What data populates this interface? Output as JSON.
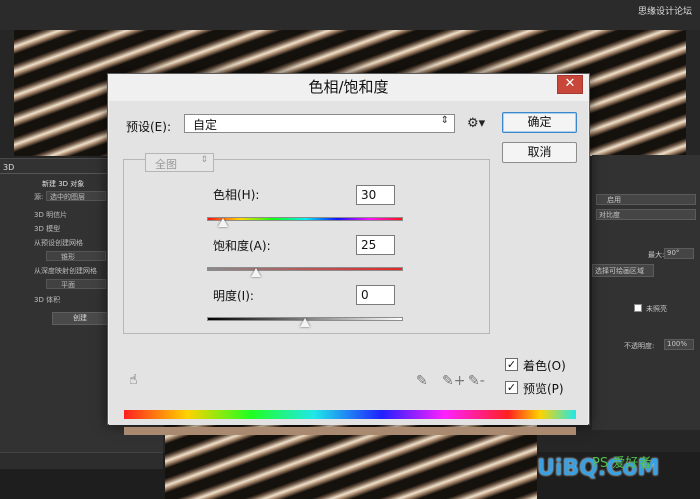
{
  "dialog": {
    "title": "色相/饱和度",
    "close_glyph": "✕",
    "preset_label": "预设(E):",
    "preset_value": "自定",
    "preset_arrow": "⇕",
    "gear_icon": "⚙▾",
    "ok_label": "确定",
    "cancel_label": "取消",
    "channel_value": "全图",
    "channel_arrow": "⇕",
    "hue": {
      "label": "色相(H):",
      "value": "30"
    },
    "saturation": {
      "label": "饱和度(A):",
      "value": "25"
    },
    "lightness": {
      "label": "明度(I):",
      "value": "0"
    },
    "colorize": {
      "label": "着色(O)",
      "checked": true
    },
    "preview": {
      "label": "预览(P)",
      "checked": true
    },
    "check_glyph": "✓",
    "slider_levels": {
      "hue": 0.08,
      "saturation": 0.25,
      "lightness": 0.5
    },
    "result_color": "#a98a70"
  },
  "icons": {
    "hand": "☝",
    "eyedropper": "✎",
    "eyedropper_plus": "✎+",
    "eyedropper_minus": "✎-"
  },
  "background": {
    "left_panel": {
      "tab": "3D",
      "header": "新建 3D 对象",
      "source_label": "源:",
      "source_value": "选中的图层",
      "options": [
        "3D 明信片",
        "3D 模型",
        "从预设创建网格",
        "从深度映射创建网格",
        "3D 体积"
      ],
      "preset_value": "锥形",
      "depth_value": "平面",
      "create_button": "创建"
    },
    "right_panel": {
      "select_1": "启用",
      "select_2": "对比度",
      "max_label": "最大:",
      "max_value": "90°",
      "select_area_button": "选择可绘画区域",
      "unlit_label": "未照亮",
      "opacity_label": "不透明度:",
      "opacity_value": "100%"
    },
    "watermark_top": "思缘设计论坛",
    "watermark_bottom": "UiBQ.CoM",
    "watermark_small": "PS 爱好者"
  }
}
